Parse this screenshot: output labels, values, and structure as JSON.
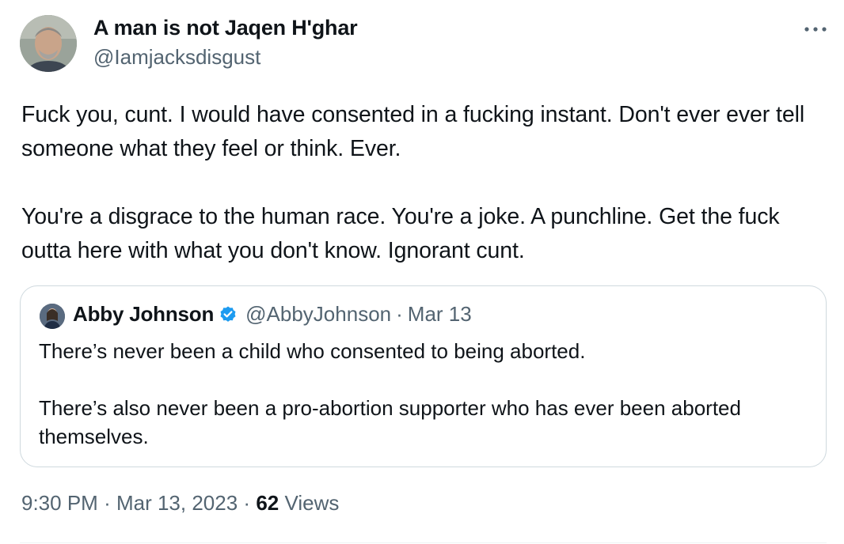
{
  "author": {
    "name": "A man is not Jaqen H'ghar",
    "handle": "@Iamjacksdisgust",
    "avatar_icon": "profile-photo"
  },
  "more_icon": "more-horizontal-icon",
  "tweet": {
    "paragraphs": [
      "Fuck you, cunt. I would have consented in a fucking instant. Don't ever ever tell someone what they feel or think. Ever.",
      "You're a disgrace to the human race. You're a joke. A punchline. Get the fuck outta here with what you don't know. Ignorant cunt."
    ]
  },
  "quoted": {
    "name": "Abby Johnson",
    "verified_icon": "verified-badge-icon",
    "handle": "@AbbyJohnson",
    "separator": "·",
    "date": "Mar 13",
    "paragraphs": [
      "There’s never been a child who consented to being aborted.",
      "There’s also never been a pro-abortion supporter who has ever been aborted themselves."
    ]
  },
  "meta": {
    "time": "9:30 PM",
    "separator": "·",
    "date": "Mar 13, 2023",
    "views_count": "62",
    "views_label": "Views"
  },
  "colors": {
    "text": "#0f1419",
    "secondary": "#536471",
    "border": "#cfd9de",
    "verified": "#1d9bf0"
  }
}
